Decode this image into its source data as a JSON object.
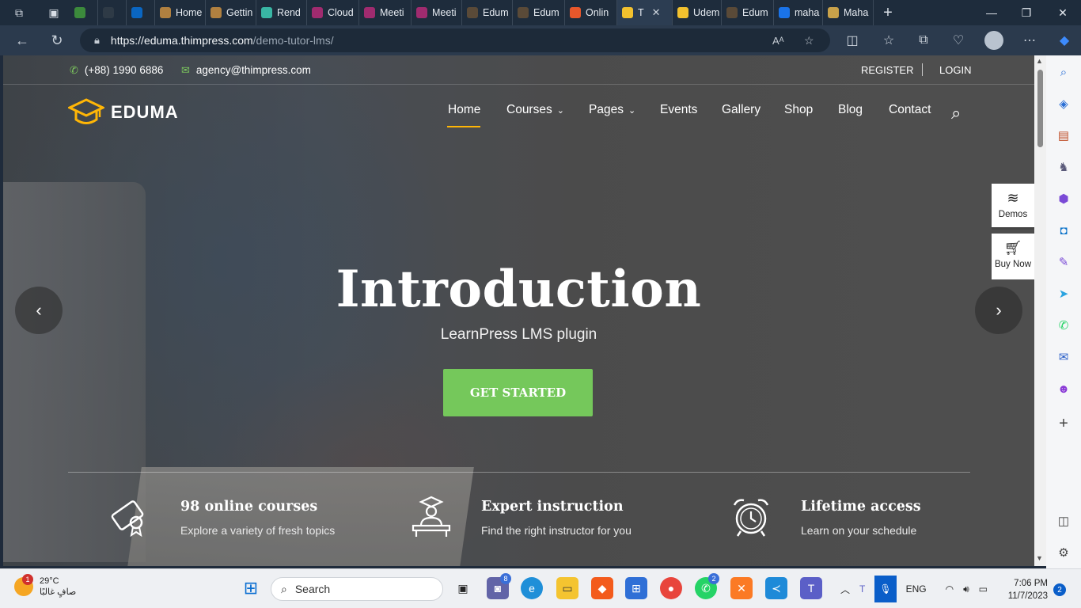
{
  "browser": {
    "tabs": [
      {
        "label": "",
        "color": "#3c8a3c"
      },
      {
        "label": "",
        "color": "#2e3a46"
      },
      {
        "label": "",
        "color": "#0a66c2"
      },
      {
        "label": "Home",
        "color": "#b08040"
      },
      {
        "label": "Gettin",
        "color": "#b08040"
      },
      {
        "label": "Rend",
        "color": "#39b6a4"
      },
      {
        "label": "Cloud",
        "color": "#a02b6f"
      },
      {
        "label": "Meeti",
        "color": "#a02b6f"
      },
      {
        "label": "Meeti",
        "color": "#a02b6f"
      },
      {
        "label": "Edum",
        "color": "#5a4a38"
      },
      {
        "label": "Edum",
        "color": "#5a4a38"
      },
      {
        "label": "Onlin",
        "color": "#e8572b"
      },
      {
        "label": "T",
        "color": "#f2c12e",
        "active": true
      },
      {
        "label": "Udem",
        "color": "#f2c12e"
      },
      {
        "label": "Edum",
        "color": "#5a4a38"
      },
      {
        "label": "maha",
        "color": "#1a73e8"
      },
      {
        "label": "Maha",
        "color": "#c9a24a"
      }
    ],
    "url_host": "https://eduma.thimpress.com",
    "url_path": "/demo-tutor-lms/"
  },
  "site": {
    "phone": "(+88) 1990 6886",
    "email": "agency@thimpress.com",
    "register": "REGISTER",
    "login": "LOGIN",
    "logo_text": "EDUMA",
    "nav": [
      "Home",
      "Courses",
      "Pages",
      "Events",
      "Gallery",
      "Shop",
      "Blog",
      "Contact"
    ],
    "hero": {
      "title": "Introduction",
      "subtitle": "LearnPress LMS plugin",
      "cta": "GET STARTED"
    },
    "features": [
      {
        "title": "98 online courses",
        "desc": "Explore a variety of fresh topics",
        "icon": "certificate-icon"
      },
      {
        "title": "Expert instruction",
        "desc": "Find the right instructor for you",
        "icon": "instructor-icon"
      },
      {
        "title": "Lifetime access",
        "desc": "Learn on your schedule",
        "icon": "alarm-clock-icon"
      }
    ],
    "side": {
      "demos": "Demos",
      "buy": "Buy Now"
    }
  },
  "taskbar": {
    "weather_temp": "29°C",
    "weather_desc": "صافٍ غالبًا",
    "weather_badge": "1",
    "search": "Search",
    "teams_badge": "8",
    "whatsapp_badge": "2",
    "lang": "ENG",
    "time": "7:06 PM",
    "date": "11/7/2023",
    "notif": "2"
  },
  "colors": {
    "accent": "#75c85b",
    "nav_underline": "#ffb606",
    "logo": "#ffb606"
  }
}
